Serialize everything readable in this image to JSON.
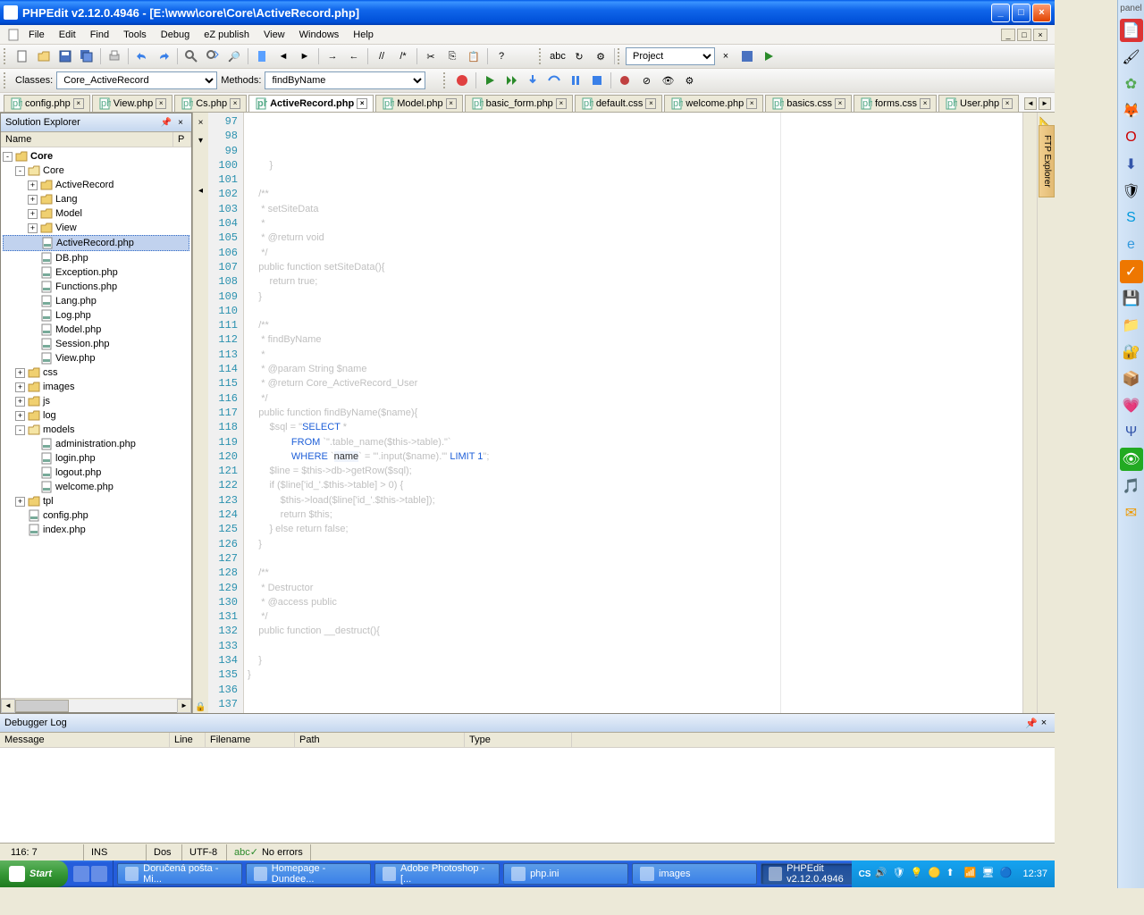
{
  "title": "PHPEdit v2.12.0.4946 - [E:\\www\\core\\Core\\ActiveRecord.php]",
  "menu": [
    "File",
    "Edit",
    "Find",
    "Tools",
    "Debug",
    "eZ publish",
    "View",
    "Windows",
    "Help"
  ],
  "toolbar2": {
    "classes_label": "Classes:",
    "classes_value": "Core_ActiveRecord",
    "methods_label": "Methods:",
    "methods_value": "findByName",
    "project_label": "Project"
  },
  "tabs": [
    {
      "name": "config.php",
      "active": false
    },
    {
      "name": "View.php",
      "active": false
    },
    {
      "name": "Cs.php",
      "active": false
    },
    {
      "name": "ActiveRecord.php",
      "active": true
    },
    {
      "name": "Model.php",
      "active": false
    },
    {
      "name": "basic_form.php",
      "active": false
    },
    {
      "name": "default.css",
      "active": false
    },
    {
      "name": "welcome.php",
      "active": false
    },
    {
      "name": "basics.css",
      "active": false
    },
    {
      "name": "forms.css",
      "active": false
    },
    {
      "name": "User.php",
      "active": false
    }
  ],
  "solution": {
    "title": "Solution Explorer",
    "header_name": "Name",
    "header_p": "P",
    "root": "Core",
    "tree": [
      {
        "depth": 0,
        "toggle": "-",
        "icon": "folder-root",
        "label": "Core",
        "bold": true
      },
      {
        "depth": 1,
        "toggle": "-",
        "icon": "folder",
        "label": "Core"
      },
      {
        "depth": 2,
        "toggle": "+",
        "icon": "folder",
        "label": "ActiveRecord"
      },
      {
        "depth": 2,
        "toggle": "+",
        "icon": "folder",
        "label": "Lang"
      },
      {
        "depth": 2,
        "toggle": "+",
        "icon": "folder",
        "label": "Model"
      },
      {
        "depth": 2,
        "toggle": "+",
        "icon": "folder",
        "label": "View"
      },
      {
        "depth": 2,
        "toggle": "",
        "icon": "file",
        "label": "ActiveRecord.php",
        "selected": true
      },
      {
        "depth": 2,
        "toggle": "",
        "icon": "file",
        "label": "DB.php"
      },
      {
        "depth": 2,
        "toggle": "",
        "icon": "file",
        "label": "Exception.php"
      },
      {
        "depth": 2,
        "toggle": "",
        "icon": "file",
        "label": "Functions.php"
      },
      {
        "depth": 2,
        "toggle": "",
        "icon": "file",
        "label": "Lang.php"
      },
      {
        "depth": 2,
        "toggle": "",
        "icon": "file",
        "label": "Log.php"
      },
      {
        "depth": 2,
        "toggle": "",
        "icon": "file",
        "label": "Model.php"
      },
      {
        "depth": 2,
        "toggle": "",
        "icon": "file",
        "label": "Session.php"
      },
      {
        "depth": 2,
        "toggle": "",
        "icon": "file",
        "label": "View.php"
      },
      {
        "depth": 1,
        "toggle": "+",
        "icon": "folder",
        "label": "css"
      },
      {
        "depth": 1,
        "toggle": "+",
        "icon": "folder",
        "label": "images"
      },
      {
        "depth": 1,
        "toggle": "+",
        "icon": "folder",
        "label": "js"
      },
      {
        "depth": 1,
        "toggle": "+",
        "icon": "folder",
        "label": "log"
      },
      {
        "depth": 1,
        "toggle": "-",
        "icon": "folder",
        "label": "models"
      },
      {
        "depth": 2,
        "toggle": "",
        "icon": "file",
        "label": "administration.php"
      },
      {
        "depth": 2,
        "toggle": "",
        "icon": "file",
        "label": "login.php"
      },
      {
        "depth": 2,
        "toggle": "",
        "icon": "file",
        "label": "logout.php"
      },
      {
        "depth": 2,
        "toggle": "",
        "icon": "file",
        "label": "welcome.php"
      },
      {
        "depth": 1,
        "toggle": "+",
        "icon": "folder",
        "label": "tpl"
      },
      {
        "depth": 1,
        "toggle": "",
        "icon": "file",
        "label": "config.php"
      },
      {
        "depth": 1,
        "toggle": "",
        "icon": "file",
        "label": "index.php"
      }
    ]
  },
  "editor": {
    "first_line": 97,
    "lines": [
      "        }",
      "",
      "    /**",
      "     * setSiteData",
      "     *",
      "     * @return void",
      "     */",
      "    public function setSiteData(){",
      "        return true;",
      "    }",
      "",
      "    /**",
      "     * findByName",
      "     *",
      "     * @param String $name",
      "     * @return Core_ActiveRecord_User",
      "     */",
      "    public function findByName($name){",
      "        $sql = \"SELECT *",
      "                FROM `\".table_name($this->table).\"`",
      "                WHERE `name` = '\".input($name).\"' LIMIT 1\";",
      "        $line = $this->db->getRow($sql);",
      "        if ($line['id_'.$this->table] > 0) {",
      "            $this->load($line['id_'.$this->table]);",
      "            return $this;",
      "        } else return false;",
      "    }",
      "",
      "    /**",
      "     * Destructor",
      "     * @access public",
      "     */",
      "    public function __destruct(){",
      "",
      "    }",
      "}",
      "",
      "",
      "",
      "",
      "?>"
    ],
    "highlight": {
      "sql_lines": [
        18,
        19,
        20
      ],
      "keywords": [
        "SELECT",
        "FROM",
        "WHERE",
        "LIMIT 1"
      ],
      "ident": "name"
    }
  },
  "debugger": {
    "title": "Debugger Log",
    "cols": [
      "Message",
      "Line",
      "Filename",
      "Path",
      "Type"
    ]
  },
  "statusbar": {
    "pos": "116:  7",
    "ins": "INS",
    "os": "Dos",
    "enc": "UTF-8",
    "errors": "No errors"
  },
  "taskbar": {
    "start": "Start",
    "tasks": [
      {
        "label": "Doručená pošta - Mi...",
        "active": false
      },
      {
        "label": "Homepage - Dundee...",
        "active": false
      },
      {
        "label": "Adobe Photoshop - [...",
        "active": false
      },
      {
        "label": "php.ini",
        "active": false
      },
      {
        "label": "images",
        "active": false
      },
      {
        "label": "PHPEdit v2.12.0.4946",
        "active": true
      }
    ],
    "lang": "CS",
    "clock": "12:37"
  },
  "sidetab": "FTP Explorer",
  "dock_label": "panel"
}
